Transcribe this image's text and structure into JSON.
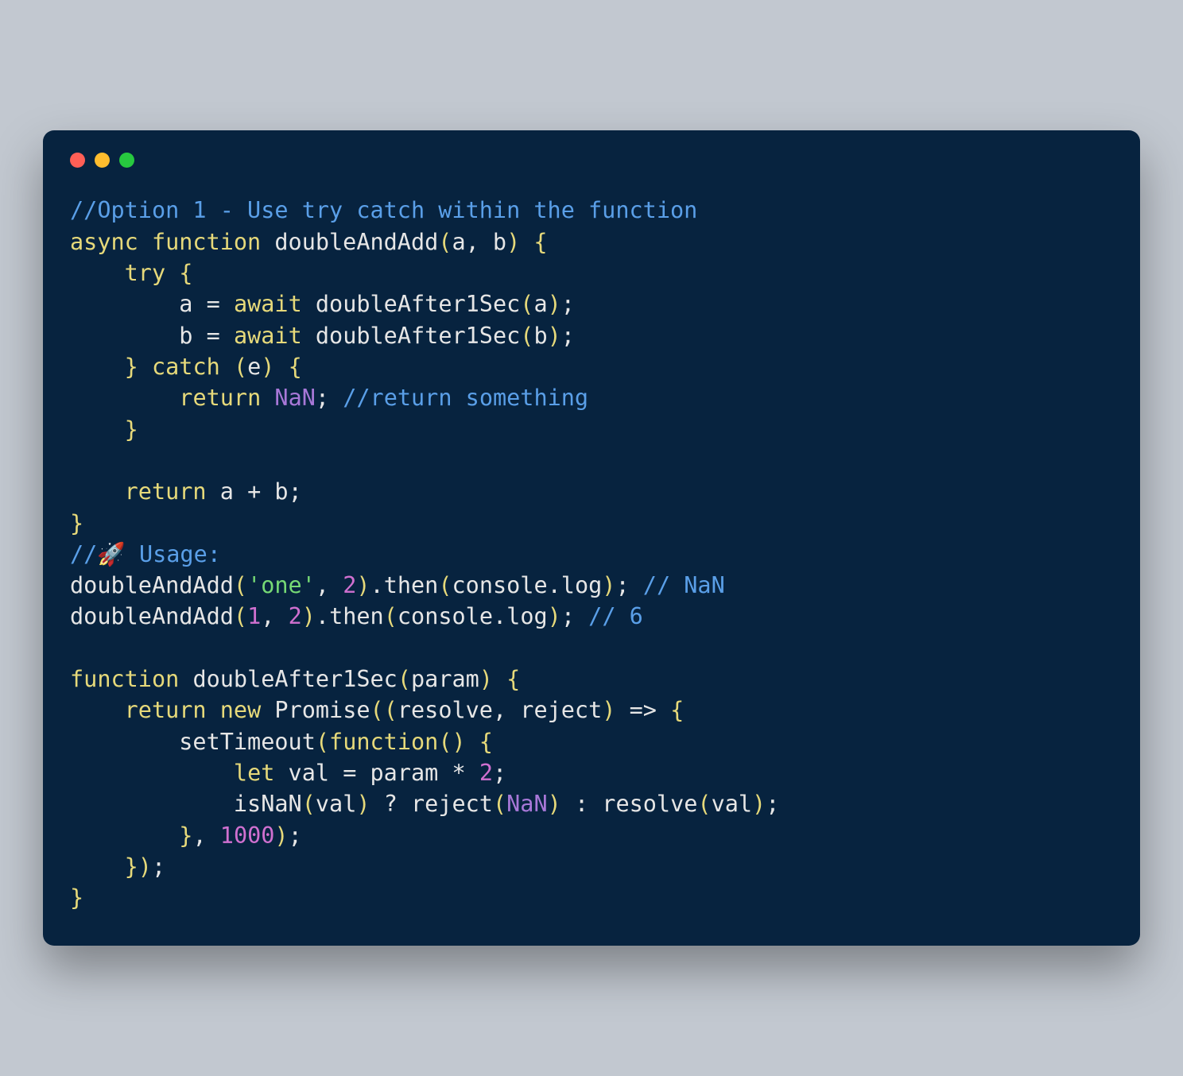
{
  "code": {
    "tokens": [
      {
        "t": "//Option 1 - Use try catch within the function",
        "c": "c-comment"
      },
      {
        "t": "\n"
      },
      {
        "t": "async function",
        "c": "c-keyword"
      },
      {
        "t": " doubleAndAdd",
        "c": "c-func"
      },
      {
        "t": "(",
        "c": "c-paren"
      },
      {
        "t": "a, b",
        "c": "c-param"
      },
      {
        "t": ")",
        "c": "c-paren"
      },
      {
        "t": " {",
        "c": "c-paren"
      },
      {
        "t": "\n    "
      },
      {
        "t": "try",
        "c": "c-keyword"
      },
      {
        "t": " {",
        "c": "c-paren"
      },
      {
        "t": "\n        a ",
        "c": "c-ident"
      },
      {
        "t": "=",
        "c": "c-op"
      },
      {
        "t": " "
      },
      {
        "t": "await",
        "c": "c-keyword"
      },
      {
        "t": " doubleAfter1Sec",
        "c": "c-func"
      },
      {
        "t": "(",
        "c": "c-paren"
      },
      {
        "t": "a",
        "c": "c-ident"
      },
      {
        "t": ")",
        "c": "c-paren"
      },
      {
        "t": ";",
        "c": "c-op"
      },
      {
        "t": "\n        b ",
        "c": "c-ident"
      },
      {
        "t": "=",
        "c": "c-op"
      },
      {
        "t": " "
      },
      {
        "t": "await",
        "c": "c-keyword"
      },
      {
        "t": " doubleAfter1Sec",
        "c": "c-func"
      },
      {
        "t": "(",
        "c": "c-paren"
      },
      {
        "t": "b",
        "c": "c-ident"
      },
      {
        "t": ")",
        "c": "c-paren"
      },
      {
        "t": ";",
        "c": "c-op"
      },
      {
        "t": "\n    "
      },
      {
        "t": "}",
        "c": "c-paren"
      },
      {
        "t": " "
      },
      {
        "t": "catch",
        "c": "c-keyword"
      },
      {
        "t": " (",
        "c": "c-paren"
      },
      {
        "t": "e",
        "c": "c-ident"
      },
      {
        "t": ") {",
        "c": "c-paren"
      },
      {
        "t": "\n        "
      },
      {
        "t": "return",
        "c": "c-keyword"
      },
      {
        "t": " "
      },
      {
        "t": "NaN",
        "c": "c-const"
      },
      {
        "t": ";",
        "c": "c-op"
      },
      {
        "t": " "
      },
      {
        "t": "//return something",
        "c": "c-comment"
      },
      {
        "t": "\n    "
      },
      {
        "t": "}",
        "c": "c-paren"
      },
      {
        "t": "\n"
      },
      {
        "t": "\n    "
      },
      {
        "t": "return",
        "c": "c-keyword"
      },
      {
        "t": " a ",
        "c": "c-ident"
      },
      {
        "t": "+",
        "c": "c-op"
      },
      {
        "t": " b",
        "c": "c-ident"
      },
      {
        "t": ";",
        "c": "c-op"
      },
      {
        "t": "\n"
      },
      {
        "t": "}",
        "c": "c-paren"
      },
      {
        "t": "\n"
      },
      {
        "t": "//🚀 Usage:",
        "c": "c-comment"
      },
      {
        "t": "\n"
      },
      {
        "t": "doubleAndAdd",
        "c": "c-func"
      },
      {
        "t": "(",
        "c": "c-paren"
      },
      {
        "t": "'one'",
        "c": "c-string"
      },
      {
        "t": ", ",
        "c": "c-op"
      },
      {
        "t": "2",
        "c": "c-number"
      },
      {
        "t": ")",
        "c": "c-paren"
      },
      {
        "t": ".then",
        "c": "c-func"
      },
      {
        "t": "(",
        "c": "c-paren"
      },
      {
        "t": "console.log",
        "c": "c-ident"
      },
      {
        "t": ")",
        "c": "c-paren"
      },
      {
        "t": ";",
        "c": "c-op"
      },
      {
        "t": " "
      },
      {
        "t": "// NaN",
        "c": "c-comment"
      },
      {
        "t": "\n"
      },
      {
        "t": "doubleAndAdd",
        "c": "c-func"
      },
      {
        "t": "(",
        "c": "c-paren"
      },
      {
        "t": "1",
        "c": "c-number"
      },
      {
        "t": ", ",
        "c": "c-op"
      },
      {
        "t": "2",
        "c": "c-number"
      },
      {
        "t": ")",
        "c": "c-paren"
      },
      {
        "t": ".then",
        "c": "c-func"
      },
      {
        "t": "(",
        "c": "c-paren"
      },
      {
        "t": "console.log",
        "c": "c-ident"
      },
      {
        "t": ")",
        "c": "c-paren"
      },
      {
        "t": ";",
        "c": "c-op"
      },
      {
        "t": " "
      },
      {
        "t": "// 6",
        "c": "c-comment"
      },
      {
        "t": "\n"
      },
      {
        "t": "\n"
      },
      {
        "t": "function",
        "c": "c-keyword"
      },
      {
        "t": " doubleAfter1Sec",
        "c": "c-func"
      },
      {
        "t": "(",
        "c": "c-paren"
      },
      {
        "t": "param",
        "c": "c-param"
      },
      {
        "t": ")",
        "c": "c-paren"
      },
      {
        "t": " {",
        "c": "c-paren"
      },
      {
        "t": "\n    "
      },
      {
        "t": "return",
        "c": "c-keyword"
      },
      {
        "t": " "
      },
      {
        "t": "new",
        "c": "c-new"
      },
      {
        "t": " Promise",
        "c": "c-class"
      },
      {
        "t": "((",
        "c": "c-paren"
      },
      {
        "t": "resolve, reject",
        "c": "c-param"
      },
      {
        "t": ")",
        "c": "c-paren"
      },
      {
        "t": " => ",
        "c": "c-op"
      },
      {
        "t": "{",
        "c": "c-paren"
      },
      {
        "t": "\n        setTimeout",
        "c": "c-func"
      },
      {
        "t": "(",
        "c": "c-paren"
      },
      {
        "t": "function",
        "c": "c-keyword"
      },
      {
        "t": "()",
        "c": "c-paren"
      },
      {
        "t": " {",
        "c": "c-paren"
      },
      {
        "t": "\n            "
      },
      {
        "t": "let",
        "c": "c-keyword"
      },
      {
        "t": " val ",
        "c": "c-ident"
      },
      {
        "t": "=",
        "c": "c-op"
      },
      {
        "t": " param ",
        "c": "c-ident"
      },
      {
        "t": "*",
        "c": "c-op"
      },
      {
        "t": " "
      },
      {
        "t": "2",
        "c": "c-number"
      },
      {
        "t": ";",
        "c": "c-op"
      },
      {
        "t": "\n            isNaN",
        "c": "c-func"
      },
      {
        "t": "(",
        "c": "c-paren"
      },
      {
        "t": "val",
        "c": "c-ident"
      },
      {
        "t": ")",
        "c": "c-paren"
      },
      {
        "t": " ? ",
        "c": "c-op"
      },
      {
        "t": "reject",
        "c": "c-func"
      },
      {
        "t": "(",
        "c": "c-paren"
      },
      {
        "t": "NaN",
        "c": "c-const"
      },
      {
        "t": ")",
        "c": "c-paren"
      },
      {
        "t": " : ",
        "c": "c-op"
      },
      {
        "t": "resolve",
        "c": "c-func"
      },
      {
        "t": "(",
        "c": "c-paren"
      },
      {
        "t": "val",
        "c": "c-ident"
      },
      {
        "t": ")",
        "c": "c-paren"
      },
      {
        "t": ";",
        "c": "c-op"
      },
      {
        "t": "\n        "
      },
      {
        "t": "}",
        "c": "c-paren"
      },
      {
        "t": ", ",
        "c": "c-op"
      },
      {
        "t": "1000",
        "c": "c-number"
      },
      {
        "t": ")",
        "c": "c-paren"
      },
      {
        "t": ";",
        "c": "c-op"
      },
      {
        "t": "\n    "
      },
      {
        "t": "})",
        "c": "c-paren"
      },
      {
        "t": ";",
        "c": "c-op"
      },
      {
        "t": "\n"
      },
      {
        "t": "}",
        "c": "c-paren"
      }
    ]
  }
}
